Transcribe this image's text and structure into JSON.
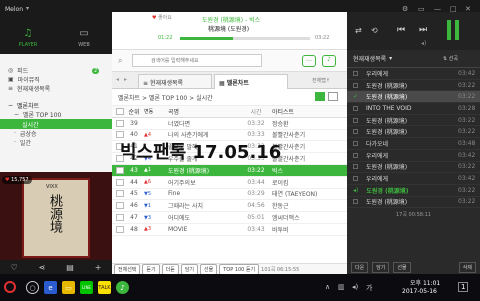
{
  "app": {
    "title": "Melon"
  },
  "left_tabs": [
    {
      "label": "PLAYER"
    },
    {
      "label": "WEB"
    }
  ],
  "nav": {
    "items": [
      {
        "label": "피드"
      },
      {
        "label": "마이뮤직"
      },
      {
        "label": "현재재생목록"
      }
    ],
    "chart_section": "멜론차트",
    "sub_items": [
      {
        "label": "멜론 TOP 100"
      },
      {
        "label": "실시간"
      },
      {
        "label": "급상승"
      },
      {
        "label": "일간"
      }
    ],
    "badge": "2"
  },
  "album": {
    "like_count": "15,757",
    "art_text": "桃源境",
    "label_text": "VIXX"
  },
  "player": {
    "like_label": "좋아요",
    "song": "도원경 (桃源境) - 빅스",
    "song_sub": "桃源境 (도원경)",
    "elapsed": "01:22",
    "total": "03:22",
    "progress": 0.41
  },
  "toolbar": {
    "search_placeholder": "검색어를 입력해주세요"
  },
  "tabs": [
    {
      "label": "현재재생목록"
    },
    {
      "label": "멜론차트"
    }
  ],
  "tabs_right": "전체탭↑",
  "breadcrumb": "멜론차트 > 멜론 TOP 100 > 실시간",
  "table": {
    "headers": [
      "순위",
      "변동",
      "곡명",
      "시간",
      "아티스트"
    ],
    "rows": [
      {
        "rank": "39",
        "change": "",
        "title": "너였다면",
        "time": "03:32",
        "artist": "정승환"
      },
      {
        "rank": "40",
        "change": "▲4",
        "title": "나의 사춘기에게",
        "time": "03:33",
        "artist": "볼빨간사춘기"
      },
      {
        "rank": "41",
        "change": "",
        "title": "좋다고 말해",
        "time": "03:32",
        "artist": "볼빨간사춘기"
      },
      {
        "rank": "42",
        "change": "▼4",
        "title": "우주를 줄게",
        "time": "03:33",
        "artist": "볼빨간사춘기"
      },
      {
        "rank": "43",
        "change": "▲1",
        "title": "도원경 (桃源境)",
        "time": "03:22",
        "artist": "빅스"
      },
      {
        "rank": "44",
        "change": "▲6",
        "title": "어기주의보",
        "time": "03:44",
        "artist": "로이킴"
      },
      {
        "rank": "45",
        "change": "▼5",
        "title": "Fine",
        "time": "03:29",
        "artist": "태연 (TAEYEON)"
      },
      {
        "rank": "46",
        "change": "▼1",
        "title": "그때라는 사치",
        "time": "04:56",
        "artist": "한동근"
      },
      {
        "rank": "47",
        "change": "▼3",
        "title": "어디에도",
        "time": "05:01",
        "artist": "엠씨더맥스"
      },
      {
        "rank": "48",
        "change": "▲3",
        "title": "MOVIE",
        "time": "03:43",
        "artist": "비투비"
      }
    ]
  },
  "bottom_bar": {
    "buttons": [
      "전체선택",
      "듣기",
      "더듣",
      "담기",
      "선물",
      "TOP 100 듣기"
    ],
    "info": "101곡 06:15:55"
  },
  "overlay_text": "빅스팬톡 17.05.16",
  "right": {
    "header": "현재재생목록",
    "sort_label": "선곡",
    "items": [
      {
        "name": "우리에게",
        "dur": "03:42"
      },
      {
        "name": "도원경 (桃源境)",
        "dur": "03:22"
      },
      {
        "name": "도원경 (桃源境)",
        "dur": "03:22"
      },
      {
        "name": "INTO THE VOID",
        "dur": "03:28"
      },
      {
        "name": "도원경 (桃源境)",
        "dur": "03:22"
      },
      {
        "name": "도원경 (桃源境)",
        "dur": "03:22"
      },
      {
        "name": "다가오네",
        "dur": "03:48"
      },
      {
        "name": "우리에게",
        "dur": "03:42"
      },
      {
        "name": "도원경 (桃源境)",
        "dur": "03:22"
      },
      {
        "name": "우리에게",
        "dur": "03:42"
      },
      {
        "name": "도원경 (桃源境)",
        "dur": "03:22"
      },
      {
        "name": "도원경 (桃源境)",
        "dur": "03:22"
      }
    ],
    "footer_info": "17곡 00:58:11",
    "footer_buttons": [
      "다운",
      "담기",
      "선물",
      "삭제"
    ]
  },
  "taskbar": {
    "time": "오후 11:01",
    "date": "2017-05-16",
    "lang": "가",
    "notify": "1"
  },
  "colors": {
    "accent": "#3db63d",
    "dark": "#1a1a1a",
    "up": "#e03030",
    "down": "#3060d0"
  }
}
